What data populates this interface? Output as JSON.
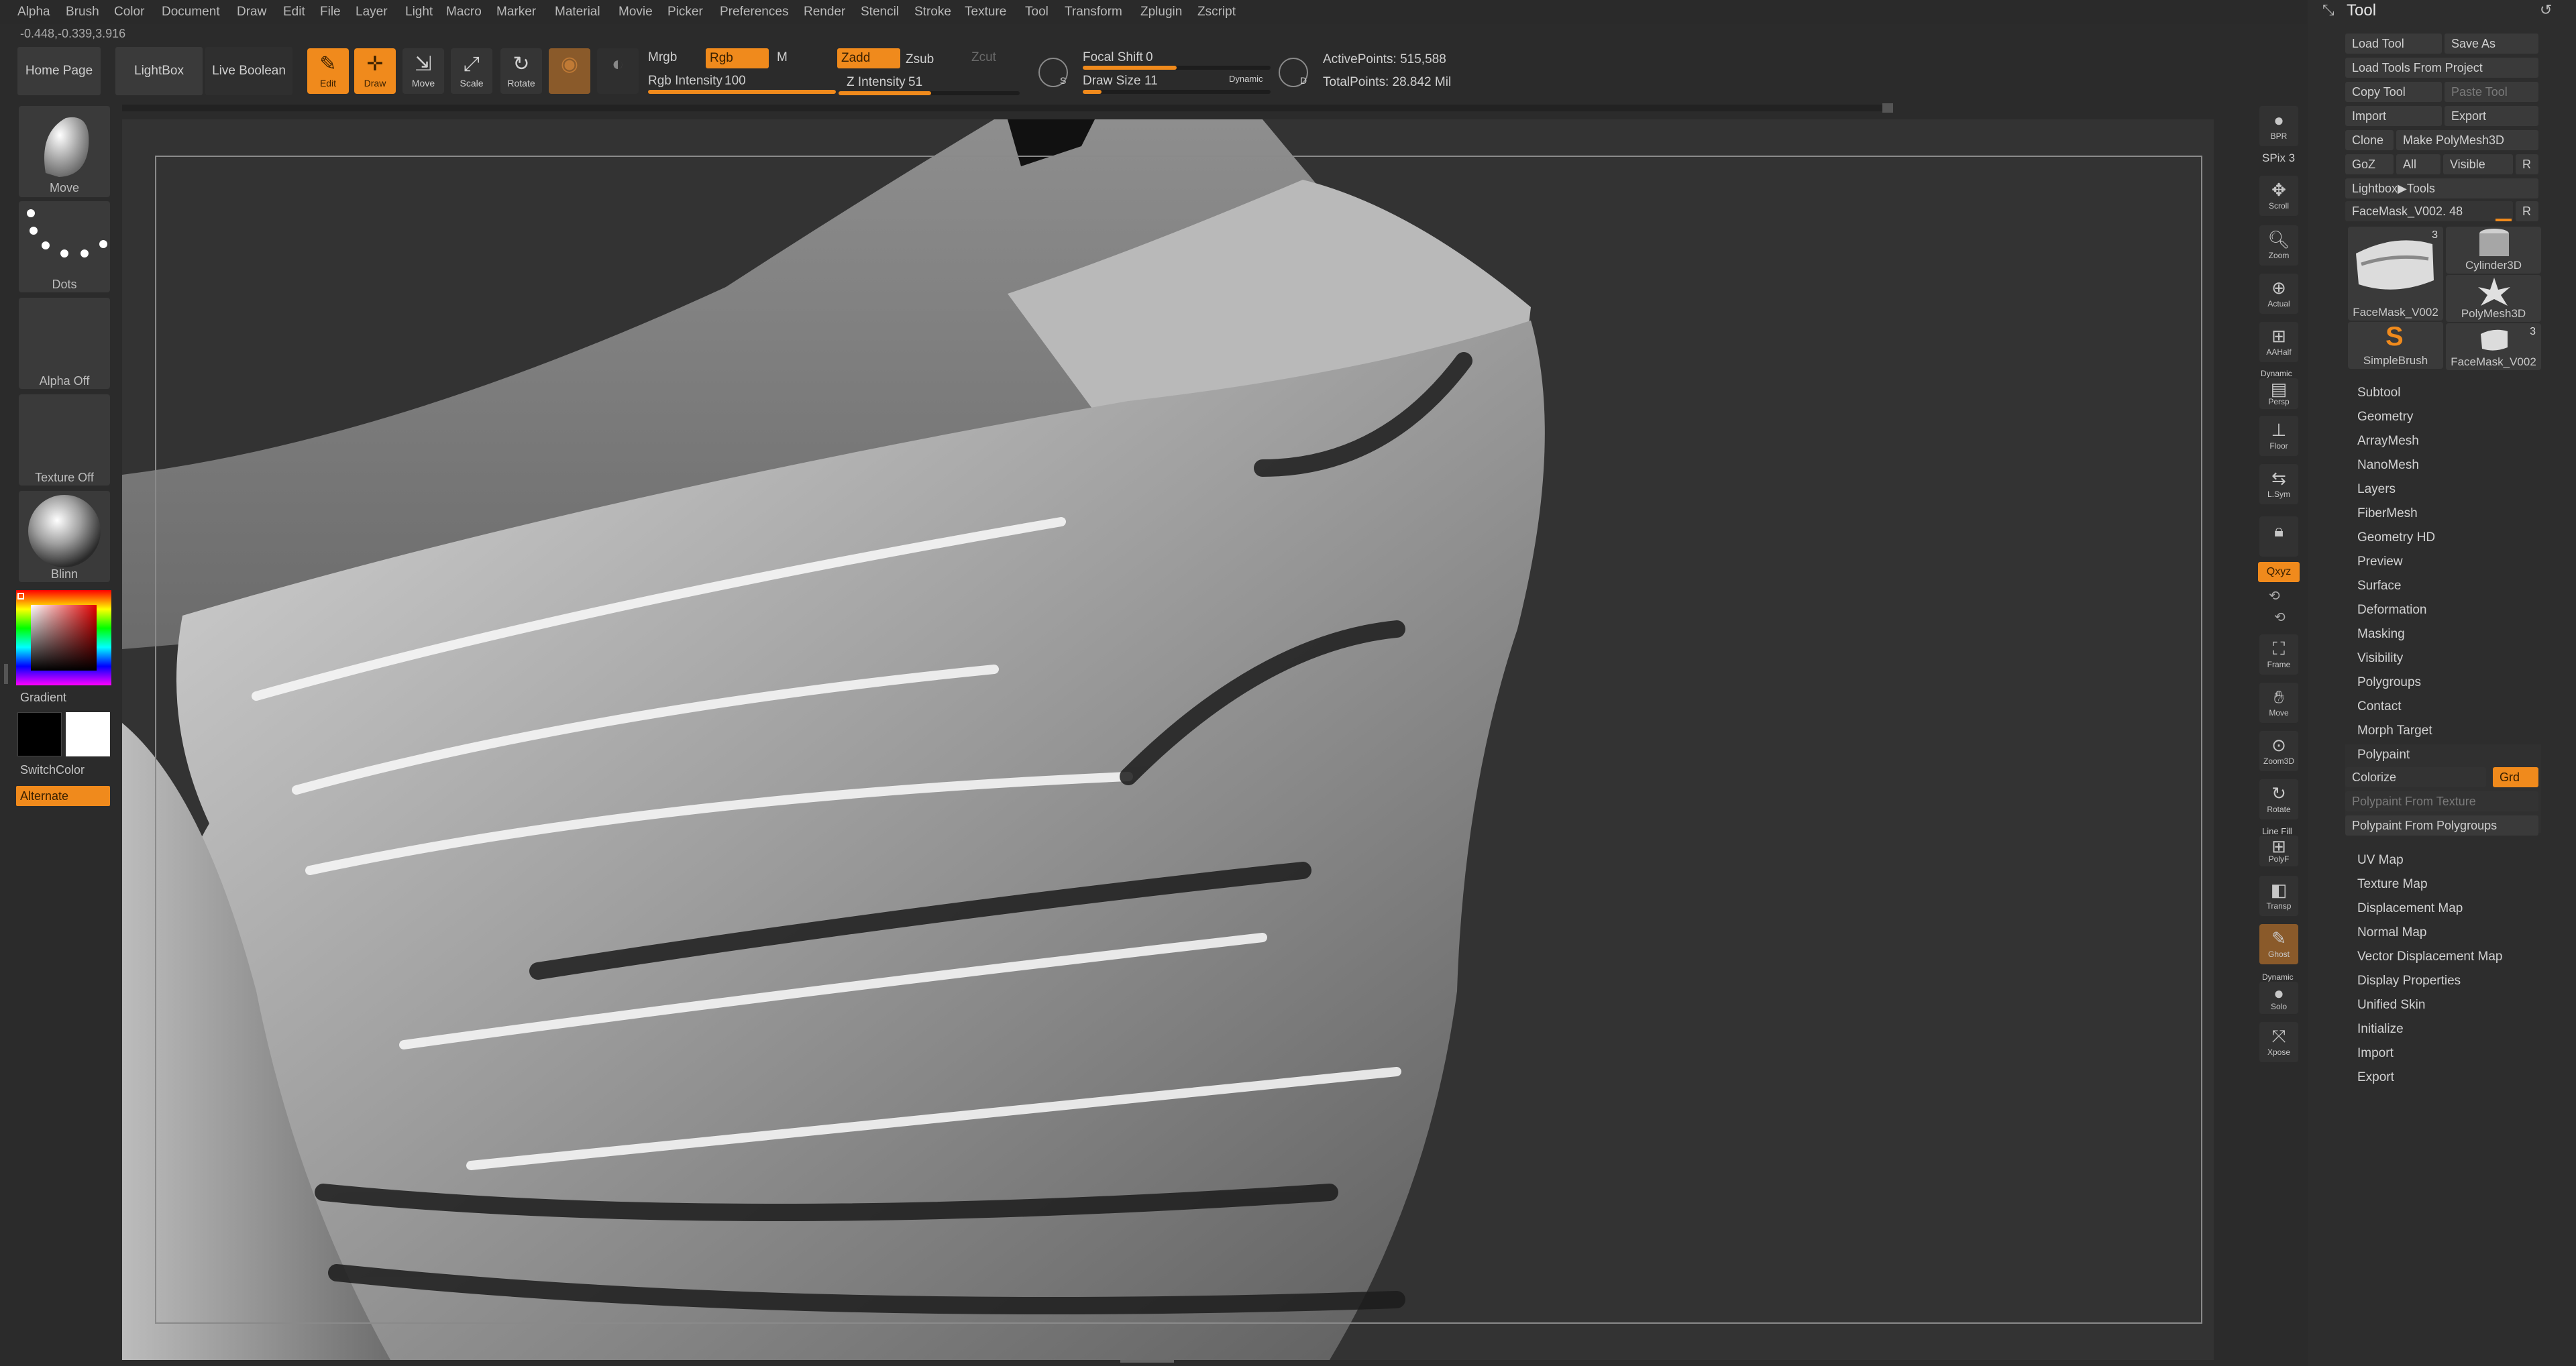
{
  "menu": [
    "Alpha",
    "Brush",
    "Color",
    "Document",
    "Draw",
    "Edit",
    "File",
    "Layer",
    "Light",
    "Macro",
    "Marker",
    "Material",
    "Movie",
    "Picker",
    "Preferences",
    "Render",
    "Stencil",
    "Stroke",
    "Texture",
    "Tool",
    "Transform",
    "Zplugin",
    "Zscript"
  ],
  "coords": "-0.448,-0.339,3.916",
  "shelf": {
    "home_page": "Home Page",
    "lightbox": "LightBox",
    "live_boolean": "Live Boolean",
    "edit": "Edit",
    "draw": "Draw",
    "move": "Move",
    "scale": "Scale",
    "rotate": "Rotate",
    "mrgb": "Mrgb",
    "rgb": "Rgb",
    "m": "M",
    "rgb_intensity_label": "Rgb Intensity",
    "rgb_intensity_value": "100",
    "zadd": "Zadd",
    "zsub": "Zsub",
    "zcut": "Zcut",
    "z_intensity_label": "Z Intensity",
    "z_intensity_value": "51",
    "focal_shift_label": "Focal Shift",
    "focal_shift_value": "0",
    "draw_size_label": "Draw Size",
    "draw_size_value": "11",
    "dynamic": "Dynamic",
    "active_points": "ActivePoints: 515,588",
    "total_points": "TotalPoints: 28.842 Mil",
    "s_label": "S",
    "d_label": "D"
  },
  "left": {
    "move": "Move",
    "dots": "Dots",
    "alpha_off": "Alpha Off",
    "texture_off": "Texture Off",
    "blinn": "Blinn",
    "gradient": "Gradient",
    "switch_color": "SwitchColor",
    "alternate": "Alternate"
  },
  "right_icons": [
    {
      "name": "bpr",
      "label": "BPR"
    },
    {
      "name": "spix",
      "label": "SPix 3"
    },
    {
      "name": "scroll",
      "label": "Scroll"
    },
    {
      "name": "zoom",
      "label": "Zoom"
    },
    {
      "name": "actual",
      "label": "Actual"
    },
    {
      "name": "aahalf",
      "label": "AAHalf"
    },
    {
      "name": "persp",
      "label": "Persp"
    },
    {
      "name": "floor",
      "label": "Floor"
    },
    {
      "name": "lsym",
      "label": "L.Sym"
    },
    {
      "name": "lock",
      "label": ""
    },
    {
      "name": "xyz",
      "label": "Qxyz"
    },
    {
      "name": "frame",
      "label": "Frame"
    },
    {
      "name": "move",
      "label": "Move"
    },
    {
      "name": "zoom3d",
      "label": "Zoom3D"
    },
    {
      "name": "rotate",
      "label": "Rotate"
    },
    {
      "name": "polyf",
      "label": "PolyF"
    },
    {
      "name": "transp",
      "label": "Transp"
    },
    {
      "name": "ghost",
      "label": "Ghost"
    },
    {
      "name": "solo",
      "label": "Solo"
    },
    {
      "name": "xpose",
      "label": "Xpose"
    }
  ],
  "right_extra": {
    "dynamic": "Dynamic",
    "line_fill": "Line Fill",
    "dynamic2": "Dynamic"
  },
  "palette": {
    "title": "Tool",
    "load_tool": "Load Tool",
    "save_as": "Save As",
    "load_from_project": "Load Tools From Project",
    "copy_tool": "Copy Tool",
    "paste_tool": "Paste Tool",
    "import": "Import",
    "export": "Export",
    "clone": "Clone",
    "make_polymesh": "Make PolyMesh3D",
    "goz": "GoZ",
    "all": "All",
    "visible": "Visible",
    "r": "R",
    "lightbox_tools": "Lightbox▶Tools",
    "current_tool": "FaceMask_V002. 48",
    "r2": "R",
    "thumbs": [
      {
        "name": "FaceMask_V002",
        "count": "3"
      },
      {
        "name": "Cylinder3D",
        "count": ""
      },
      {
        "name": "PolyMesh3D",
        "count": ""
      },
      {
        "name": "SimpleBrush",
        "count": ""
      },
      {
        "name": "FaceMask_V002",
        "count": "3"
      }
    ],
    "sections_a": [
      "Subtool",
      "Geometry",
      "ArrayMesh",
      "NanoMesh",
      "Layers",
      "FiberMesh",
      "Geometry HD",
      "Preview",
      "Surface",
      "Deformation",
      "Masking",
      "Visibility",
      "Polygroups",
      "Contact",
      "Morph Target",
      "Polypaint"
    ],
    "colorize": "Colorize",
    "grd": "Grd",
    "polypaint_from_texture": "Polypaint From Texture",
    "polypaint_from_polygroups": "Polypaint From Polygroups",
    "sections_b": [
      "UV Map",
      "Texture Map",
      "Displacement Map",
      "Normal Map",
      "Vector Displacement Map",
      "Display Properties",
      "Unified Skin",
      "Initialize",
      "Import",
      "Export"
    ]
  },
  "colors": {
    "accent": "#f08a1c",
    "panel": "#2d2d2d",
    "canvas": "#333333"
  }
}
